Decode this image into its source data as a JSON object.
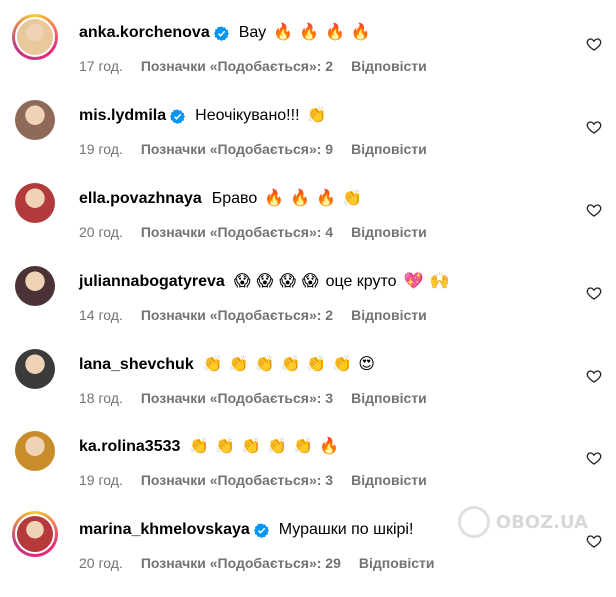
{
  "comments": [
    {
      "username": "anka.korchenova",
      "verified": true,
      "text": "Вау",
      "emojis": [
        "🔥",
        "🔥",
        "🔥",
        "🔥"
      ],
      "time": "17 год.",
      "likes": "Позначки «Подобається»: 2",
      "reply": "Відповісти",
      "avatar_color": "#e7c99b"
    },
    {
      "username": "mis.lydmila",
      "verified": true,
      "text": "Неочікувано!!!",
      "emojis": [
        "👏"
      ],
      "time": "19 год.",
      "likes": "Позначки «Подобається»: 9",
      "reply": "Відповісти",
      "avatar_color": "#8f6a5a"
    },
    {
      "username": "ella.povazhnaya",
      "verified": false,
      "text": "Браво",
      "emojis": [
        "🔥",
        "🔥",
        "🔥",
        "👏"
      ],
      "time": "20 год.",
      "likes": "Позначки «Подобається»: 4",
      "reply": "Відповісти",
      "avatar_color": "#b23a3a"
    },
    {
      "username": "juliannabogatyreva",
      "verified": false,
      "text": "оце круто",
      "emojis_before": [
        "😱",
        "😱",
        "😱",
        "😱"
      ],
      "emojis": [
        "💖",
        "🙌"
      ],
      "time": "14 год.",
      "likes": "Позначки «Подобається»: 2",
      "reply": "Відповісти",
      "avatar_color": "#4a3236"
    },
    {
      "username": "lana_shevchuk",
      "verified": false,
      "text": "",
      "emojis": [
        "👏",
        "👏",
        "👏",
        "👏",
        "👏",
        "👏",
        "😍"
      ],
      "time": "18 год.",
      "likes": "Позначки «Подобається»: 3",
      "reply": "Відповісти",
      "avatar_color": "#3b3b3b"
    },
    {
      "username": "ka.rolina3533",
      "verified": false,
      "text": "",
      "emojis": [
        "👏",
        "👏",
        "👏",
        "👏",
        "👏",
        "🔥"
      ],
      "time": "19 год.",
      "likes": "Позначки «Подобається»: 3",
      "reply": "Відповісти",
      "avatar_color": "#c98c2a"
    },
    {
      "username": "marina_khmelovskaya",
      "verified": true,
      "text": "Мурашки по шкірі!",
      "emojis": [],
      "time": "20 год.",
      "likes": "Позначки «Подобається»: 29",
      "reply": "Відповісти",
      "avatar_color": "#b63a3a"
    }
  ],
  "icons": {
    "like": "heart-outline-icon",
    "verified": "verified-badge-icon"
  },
  "colors": {
    "secondary_text": "#737373",
    "verified_blue": "#0095f6"
  },
  "watermark": "OBOZ.UA"
}
